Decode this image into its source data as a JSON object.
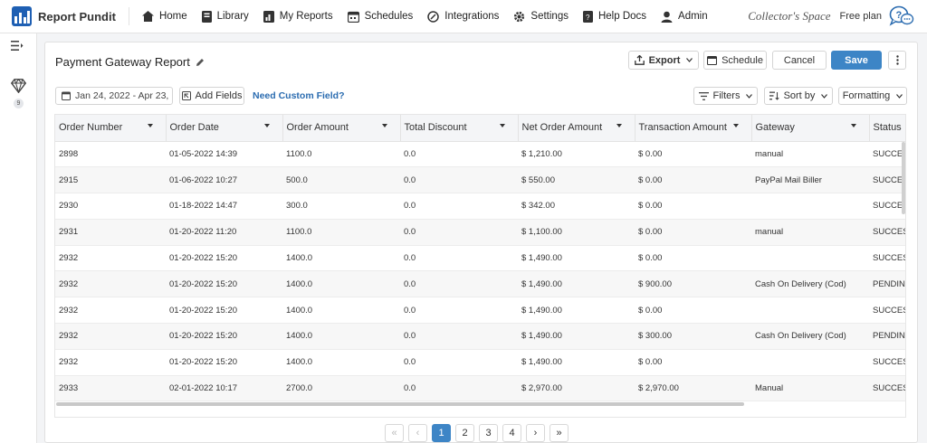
{
  "app": {
    "name": "Report Pundit"
  },
  "nav": {
    "items": [
      {
        "label": "Home",
        "icon": "home-icon"
      },
      {
        "label": "Library",
        "icon": "book-icon"
      },
      {
        "label": "My Reports",
        "icon": "report-icon"
      },
      {
        "label": "Schedules",
        "icon": "calendar-icon"
      },
      {
        "label": "Integrations",
        "icon": "integrations-icon"
      },
      {
        "label": "Settings",
        "icon": "gear-icon"
      },
      {
        "label": "Help Docs",
        "icon": "help-doc-icon"
      },
      {
        "label": "Admin",
        "icon": "admin-icon"
      }
    ],
    "collector": "Collector's Space",
    "plan": "Free plan"
  },
  "rail": {
    "badge": "9"
  },
  "report": {
    "title": "Payment Gateway Report",
    "export_label": "Export",
    "schedule_label": "Schedule",
    "cancel_label": "Cancel",
    "save_label": "Save",
    "date_range": "Jan 24, 2022 - Apr 23, ...",
    "add_fields_label": "Add Fields",
    "custom_field_link": "Need Custom Field?",
    "filters_label": "Filters",
    "sort_label": "Sort by",
    "formatting_label": "Formatting"
  },
  "table": {
    "columns": [
      "Order Number",
      "Order Date",
      "Order Amount",
      "Total Discount",
      "Net Order Amount",
      "Transaction Amount",
      "Gateway",
      "Status"
    ],
    "rows": [
      [
        "2898",
        "01-05-2022 14:39",
        "1100.0",
        "0.0",
        "$ 1,210.00",
        "$ 0.00",
        "manual",
        "SUCCESS"
      ],
      [
        "2915",
        "01-06-2022 10:27",
        "500.0",
        "0.0",
        "$ 550.00",
        "$ 0.00",
        "PayPal Mail Biller",
        "SUCCESS"
      ],
      [
        "2930",
        "01-18-2022 14:47",
        "300.0",
        "0.0",
        "$ 342.00",
        "$ 0.00",
        "",
        "SUCCESS"
      ],
      [
        "2931",
        "01-20-2022 11:20",
        "1100.0",
        "0.0",
        "$ 1,100.00",
        "$ 0.00",
        "manual",
        "SUCCESS"
      ],
      [
        "2932",
        "01-20-2022 15:20",
        "1400.0",
        "0.0",
        "$ 1,490.00",
        "$ 0.00",
        "",
        "SUCCESS"
      ],
      [
        "2932",
        "01-20-2022 15:20",
        "1400.0",
        "0.0",
        "$ 1,490.00",
        "$ 900.00",
        "Cash On Delivery (Cod)",
        "PENDING"
      ],
      [
        "2932",
        "01-20-2022 15:20",
        "1400.0",
        "0.0",
        "$ 1,490.00",
        "$ 0.00",
        "",
        "SUCCESS"
      ],
      [
        "2932",
        "01-20-2022 15:20",
        "1400.0",
        "0.0",
        "$ 1,490.00",
        "$ 300.00",
        "Cash On Delivery (Cod)",
        "PENDING"
      ],
      [
        "2932",
        "01-20-2022 15:20",
        "1400.0",
        "0.0",
        "$ 1,490.00",
        "$ 0.00",
        "",
        "SUCCESS"
      ],
      [
        "2933",
        "02-01-2022 10:17",
        "2700.0",
        "0.0",
        "$ 2,970.00",
        "$ 2,970.00",
        "Manual",
        "SUCCESS"
      ]
    ]
  },
  "pagination": {
    "first": "«",
    "prev": "‹",
    "pages": [
      "1",
      "2",
      "3",
      "4"
    ],
    "current": "1",
    "next": "›",
    "last": "»"
  },
  "colors": {
    "accent": "#3d85c6",
    "brand": "#1e5fb3"
  }
}
